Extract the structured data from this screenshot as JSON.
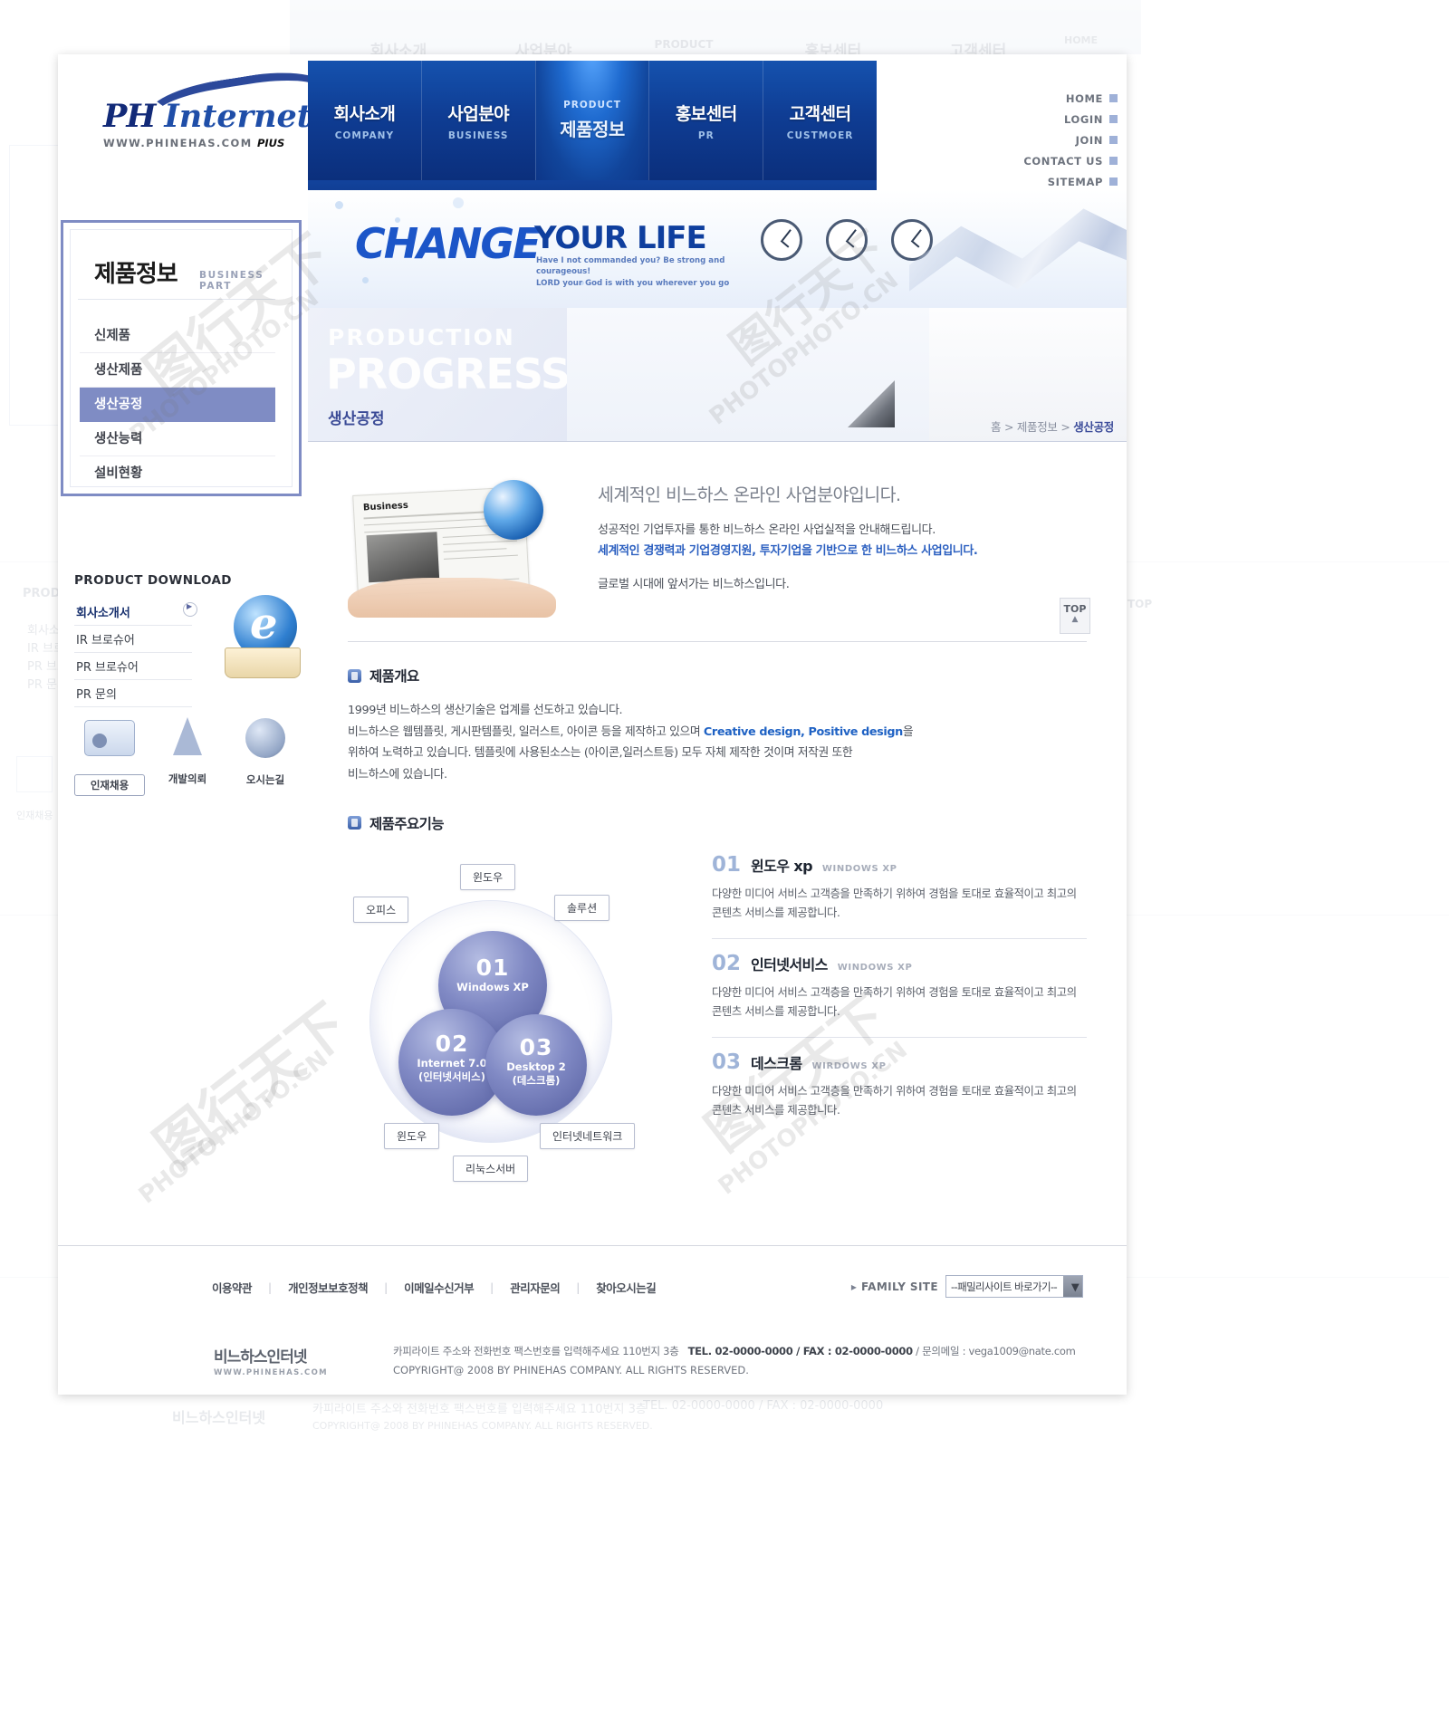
{
  "brand": {
    "logo_ph": "PH",
    "logo_internet": "Internet",
    "logo_url": "WWW.PHINEHAS.COM",
    "logo_plus": "PIUS"
  },
  "gnb": [
    {
      "ko": "회사소개",
      "en": "COMPANY"
    },
    {
      "ko": "사업분야",
      "en": "BUSINESS"
    },
    {
      "ko": "제품정보",
      "en": "PRODUCT",
      "active": true
    },
    {
      "ko": "홍보센터",
      "en": "PR"
    },
    {
      "ko": "고객센터",
      "en": "CUSTMOER"
    }
  ],
  "utility": [
    "HOME",
    "LOGIN",
    "JOIN",
    "CONTACT US",
    "SITEMAP"
  ],
  "snb": [
    {
      "label": "신제품"
    },
    {
      "label": "생산제품"
    },
    {
      "label": "생산공정",
      "active": true
    },
    {
      "label": "생산능력"
    },
    {
      "label": "설비현황"
    }
  ],
  "visual": {
    "change": "CHANGE",
    "your_life": "YOUR LIFE",
    "verse_line1": "Have I not commanded you? Be strong and courageous!",
    "verse_line2": "LORD your God is with you wherever you go"
  },
  "titlestrip": {
    "eyebrow": "PRODUCTION",
    "headline": "PROGRESS",
    "korean": "생산공정",
    "breadcrumb_home": "홈",
    "breadcrumb_sep": ">",
    "breadcrumb_section": "제품정보",
    "breadcrumb_current": "생산공정"
  },
  "lnb": {
    "title": "제품정보",
    "subtitle": "BUSINESS PART",
    "items": [
      {
        "label": "신제품"
      },
      {
        "label": "생산제품"
      },
      {
        "label": "생산공정",
        "active": true
      },
      {
        "label": "생산능력"
      },
      {
        "label": "설비현황"
      }
    ]
  },
  "product_download": {
    "title": "PRODUCT DOWNLOAD",
    "items": [
      "회사소개서",
      "IR 브로슈어",
      "PR 브로슈어",
      "PR 문의"
    ]
  },
  "quick_menu": [
    {
      "label": "인재채용",
      "icon": "id-card-icon",
      "boxed": true
    },
    {
      "label": "개발의뢰",
      "icon": "flask-icon",
      "boxed": false
    },
    {
      "label": "오시는길",
      "icon": "globe-icon",
      "boxed": false
    }
  ],
  "intro": {
    "heading": "세계적인 비느하스 온라인 사업분야입니다.",
    "line1": "성공적인 기업투자를 통한 비느하스 온라인 사업실적을 안내해드립니다.",
    "line2": "세계적인 경쟁력과 기업경영지원, 투자기업을 기반으로 한 비느하스 사업입니다.",
    "line3": "글로벌 시대에 앞서가는 비느하스입니다."
  },
  "overview": {
    "title": "제품개요",
    "p1": "1999년 비느하스의 생산기술은 업계를 선도하고 있습니다.",
    "p2_a": "비느하스은 웹템플릿, 게시판템플릿, 일러스트, 아이콘 등을 제작하고 있으며 ",
    "p2_highlight": "Creative design, Positive design",
    "p2_b": "을",
    "p3": "위하여 노력하고 있습니다. 템플릿에 사용된소스는 (아이콘,일러스트등) 모두 자체 제작한 것이며 저작권 또한",
    "p4": "비느하스에 있습니다."
  },
  "features_section": {
    "title": "제품주요기능",
    "diagram": {
      "bubbles": [
        {
          "num": "01",
          "label": "Windows XP"
        },
        {
          "num": "02",
          "label": "Internet 7.0",
          "label2": "(인터넷서비스)"
        },
        {
          "num": "03",
          "label": "Desktop 2",
          "label2": "(데스크롬)"
        }
      ],
      "tags": [
        "오피스",
        "윈도우",
        "솔루션",
        "윈도우",
        "인터넷네트워크",
        "리눅스서버"
      ]
    },
    "items": [
      {
        "num": "01",
        "title": "윈도우 xp",
        "en": "WINDOWS XP",
        "desc": "다양한 미디어 서비스 고객층을 만족하기 위하여 경험을 토대로 효율적이고 최고의 콘텐츠 서비스를 제공합니다."
      },
      {
        "num": "02",
        "title": "인터넷서비스",
        "en": "WINDOWS XP",
        "desc": "다양한 미디어 서비스 고객층을 만족하기 위하여 경험을 토대로 효율적이고 최고의 콘텐츠 서비스를 제공합니다."
      },
      {
        "num": "03",
        "title": "데스크롬",
        "en": "WIRDOWS XP",
        "desc": "다양한 미디어 서비스 고객층을 만족하기 위하여 경험을 토대로 효율적이고 최고의 콘텐츠 서비스를 제공합니다."
      }
    ]
  },
  "footer": {
    "links": [
      "이용약관",
      "개인정보보호정책",
      "이메일수신거부",
      "관리자문의",
      "찾아오시는길"
    ],
    "family_site_label": "FAMILY SITE",
    "family_site_value": "--패밀리사이트 바로가기--",
    "logo_name": "비느하스인터넷",
    "logo_url": "WWW.PHINEHAS.COM",
    "address": "카피라이트 주소와 전화번호 팩스번호를 입력해주세요 110번지 3층",
    "tel": "TEL. 02-0000-0000 / FAX : 02-0000-0000",
    "email_label": "/ 문의메일 : vega1009@nate.com",
    "copyright": "COPYRIGHT@ 2008 BY PHINEHAS COMPANY. ALL RIGHTS RESERVED."
  },
  "top_button": {
    "label": "TOP",
    "arrow": "▲"
  },
  "watermarks": [
    "图行天下",
    "PHOTOPHOTO.CN"
  ],
  "colors": {
    "nav_blue": "#0f3d94",
    "active_blue": "#1f6bd0",
    "lnb_purple": "#7f8cc4",
    "link_blue": "#2b5fc0"
  }
}
